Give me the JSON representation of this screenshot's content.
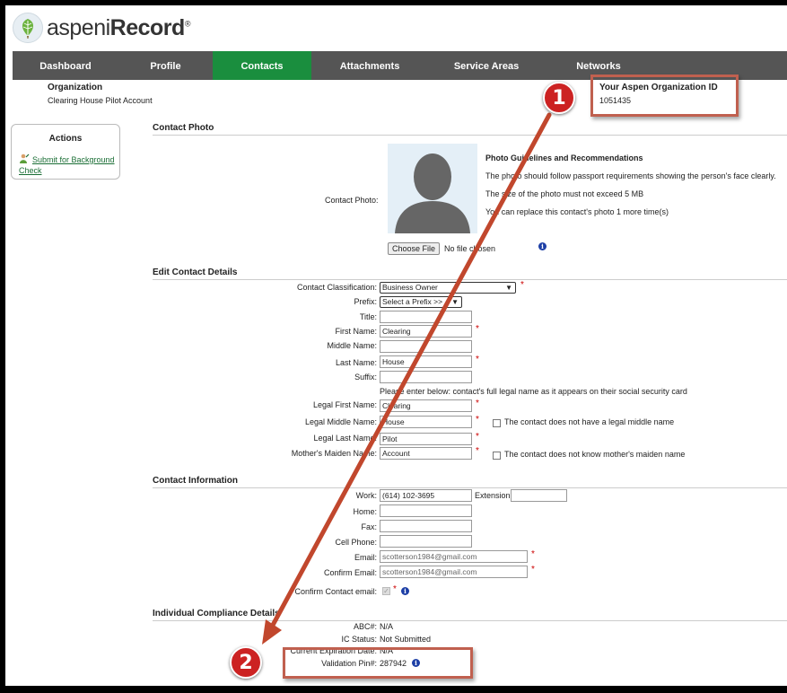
{
  "app": {
    "logo_text_light": "aspeni",
    "logo_text_bold": "Record",
    "logo_mark": "®"
  },
  "nav": {
    "items": [
      {
        "label": "Dashboard"
      },
      {
        "label": "Profile"
      },
      {
        "label": "Contacts",
        "active": true
      },
      {
        "label": "Attachments"
      },
      {
        "label": "Service Areas"
      },
      {
        "label": "Networks"
      }
    ]
  },
  "org": {
    "label": "Organization",
    "value": "Clearing House Pilot Account",
    "id_label": "Your Aspen Organization ID",
    "id_value": "1051435"
  },
  "actions": {
    "title": "Actions",
    "link": "Submit for Background Check"
  },
  "sections": {
    "photo": "Contact Photo",
    "edit": "Edit Contact Details",
    "contact_info": "Contact Information",
    "compliance": "Individual Compliance Details"
  },
  "photo": {
    "label": "Contact Photo:",
    "guide_title": "Photo Guidelines and Recommendations",
    "guide_lines": [
      "The photo should follow passport requirements showing the person's face clearly.",
      "The size of the photo must not exceed 5 MB",
      "You can replace this contact's photo 1 more time(s)"
    ],
    "choose_file": "Choose File",
    "no_file": "No file chosen"
  },
  "edit": {
    "classification_label": "Contact Classification:",
    "classification_value": "Business Owner",
    "prefix_label": "Prefix:",
    "prefix_value": "Select a Prefix >>",
    "title_label": "Title:",
    "first_name_label": "First Name:",
    "first_name_value": "Clearing",
    "middle_name_label": "Middle Name:",
    "last_name_label": "Last Name:",
    "last_name_value": "House",
    "suffix_label": "Suffix:",
    "legal_note": "Please enter below: contact's full legal name as it appears on their social security card",
    "legal_first_label": "Legal First Name:",
    "legal_first_value": "Clearing",
    "legal_middle_label": "Legal Middle Name:",
    "legal_middle_value": "House",
    "legal_middle_cb": "The contact does not have a legal middle name",
    "legal_last_label": "Legal Last Name:",
    "legal_last_value": "Pilot",
    "maiden_label": "Mother's Maiden Name:",
    "maiden_value": "Account",
    "maiden_cb": "The contact does not know mother's maiden name"
  },
  "contact_info": {
    "work_label": "Work:",
    "work_value": "(614) 102-3695",
    "extension_label": "Extension:",
    "home_label": "Home:",
    "fax_label": "Fax:",
    "cell_label": "Cell Phone:",
    "email_label": "Email:",
    "email_value": "scotterson1984@gmail.com",
    "confirm_email_label": "Confirm Email:",
    "confirm_email_value": "scotterson1984@gmail.com",
    "confirm_contact_label": "Confirm Contact email:"
  },
  "compliance": {
    "abc_label": "ABC#:",
    "abc_value": "N/A",
    "ic_label": "IC Status:",
    "ic_value": "Not Submitted",
    "exp_label": "Current Expiration Date:",
    "exp_value": "N/A",
    "pin_label": "Validation Pin#:",
    "pin_value": "287942"
  },
  "badges": {
    "one": "1",
    "two": "2"
  },
  "colors": {
    "nav_bg": "#555555",
    "nav_active": "#1a8e3e",
    "highlight": "#c0604f",
    "arrow": "#c1472d",
    "badge": "#cc2222"
  }
}
